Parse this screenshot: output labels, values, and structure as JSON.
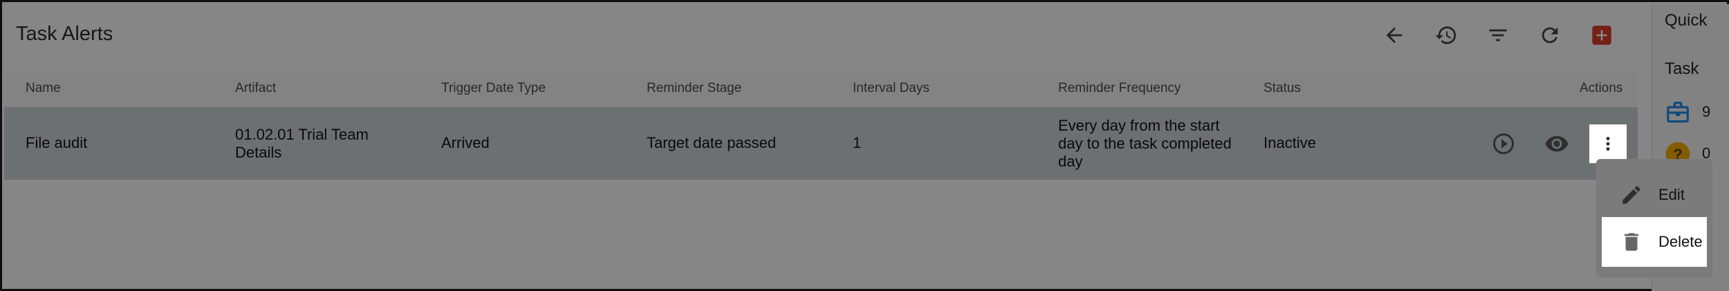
{
  "header": {
    "title": "Task Alerts"
  },
  "toolbar": {
    "buttons": [
      {
        "name": "back-button",
        "icon": "arrow-left-icon"
      },
      {
        "name": "history-button",
        "icon": "history-icon"
      },
      {
        "name": "filter-button",
        "icon": "filter-icon"
      },
      {
        "name": "refresh-button",
        "icon": "refresh-icon"
      },
      {
        "name": "add-button",
        "icon": "add-icon",
        "color": "#d83b2a"
      }
    ]
  },
  "table": {
    "columns": [
      "Name",
      "Artifact",
      "Trigger Date Type",
      "Reminder Stage",
      "Interval Days",
      "Reminder Frequency",
      "Status",
      "Actions"
    ],
    "rows": [
      {
        "name": "File audit",
        "artifact": "01.02.01 Trial Team Details",
        "trigger_date_type": "Arrived",
        "reminder_stage": "Target date passed",
        "interval_days": "1",
        "reminder_frequency": "Every day from the start day to the task completed day",
        "status": "Inactive",
        "actions": [
          "play-icon",
          "eye-icon",
          "more-vert-icon"
        ]
      }
    ]
  },
  "side_panel": {
    "label": "Quick",
    "section": "Task",
    "items": [
      {
        "icon": "briefcase-icon",
        "count": "9",
        "color": "#1e88e5"
      },
      {
        "icon": "help-icon",
        "count": "0",
        "color": "#f2a900"
      }
    ]
  },
  "context_menu": {
    "items": [
      {
        "label": "Edit",
        "icon": "pencil-icon"
      },
      {
        "label": "Delete",
        "icon": "trash-icon"
      }
    ]
  }
}
